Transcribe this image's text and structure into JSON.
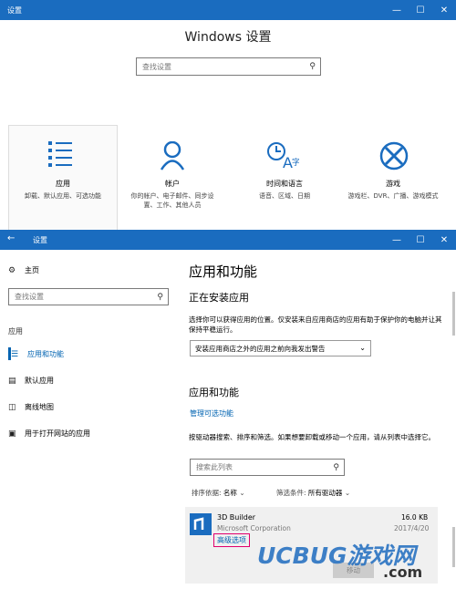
{
  "window1": {
    "title": "设置",
    "heading": "Windows 设置",
    "search_placeholder": "查找设置",
    "controls": {
      "minimize": "—",
      "maximize": "☐",
      "close": "✕"
    },
    "categories": [
      {
        "name": "应用",
        "desc": "卸载、默认应用、可选功能",
        "icon": "apps-list-icon"
      },
      {
        "name": "帐户",
        "desc": "你的帐户、电子邮件、同步设置、工作、其他人员",
        "icon": "person-icon"
      },
      {
        "name": "时间和语言",
        "desc": "语音、区域、日期",
        "icon": "time-language-icon"
      },
      {
        "name": "游戏",
        "desc": "游戏栏、DVR、广播、游戏模式",
        "icon": "xbox-icon"
      }
    ]
  },
  "window2": {
    "title": "设置",
    "back": "←",
    "home": "主页",
    "search_placeholder": "查找设置",
    "section_label": "应用",
    "nav": [
      {
        "label": "应用和功能",
        "active": true,
        "icon": "apps-list-icon"
      },
      {
        "label": "默认应用",
        "active": false,
        "icon": "default-apps-icon"
      },
      {
        "label": "离线地图",
        "active": false,
        "icon": "offline-map-icon"
      },
      {
        "label": "用于打开网站的应用",
        "active": false,
        "icon": "website-app-icon"
      }
    ],
    "page_title": "应用和功能",
    "installing_title": "正在安装应用",
    "installing_desc": "选择你可以获得应用的位置。仅安装来自应用商店的应用有助于保护你的电脑并让其保持平稳运行。",
    "install_source": "安装应用商店之外的应用之前向我发出警告",
    "apps_title": "应用和功能",
    "optional_link": "管理可选功能",
    "apps_desc": "按驱动器搜索、排序和筛选。如果想要卸载或移动一个应用，请从列表中选择它。",
    "list_search_placeholder": "搜索此列表",
    "sort_label": "排序依据:",
    "sort_value": "名称",
    "filter_label": "筛选条件:",
    "filter_value": "所有驱动器",
    "app": {
      "name": "3D Builder",
      "publisher": "Microsoft Corporation",
      "size": "16.0 KB",
      "date": "2017/4/20",
      "advanced_link": "高级选项",
      "move_button": "移动"
    }
  },
  "watermark": {
    "text": "UCBUG游戏网",
    "sub": ".com"
  },
  "colors": {
    "titlebar": "#1a6cbf",
    "accent": "#0063b1",
    "highlight_box": "#e0006e"
  }
}
